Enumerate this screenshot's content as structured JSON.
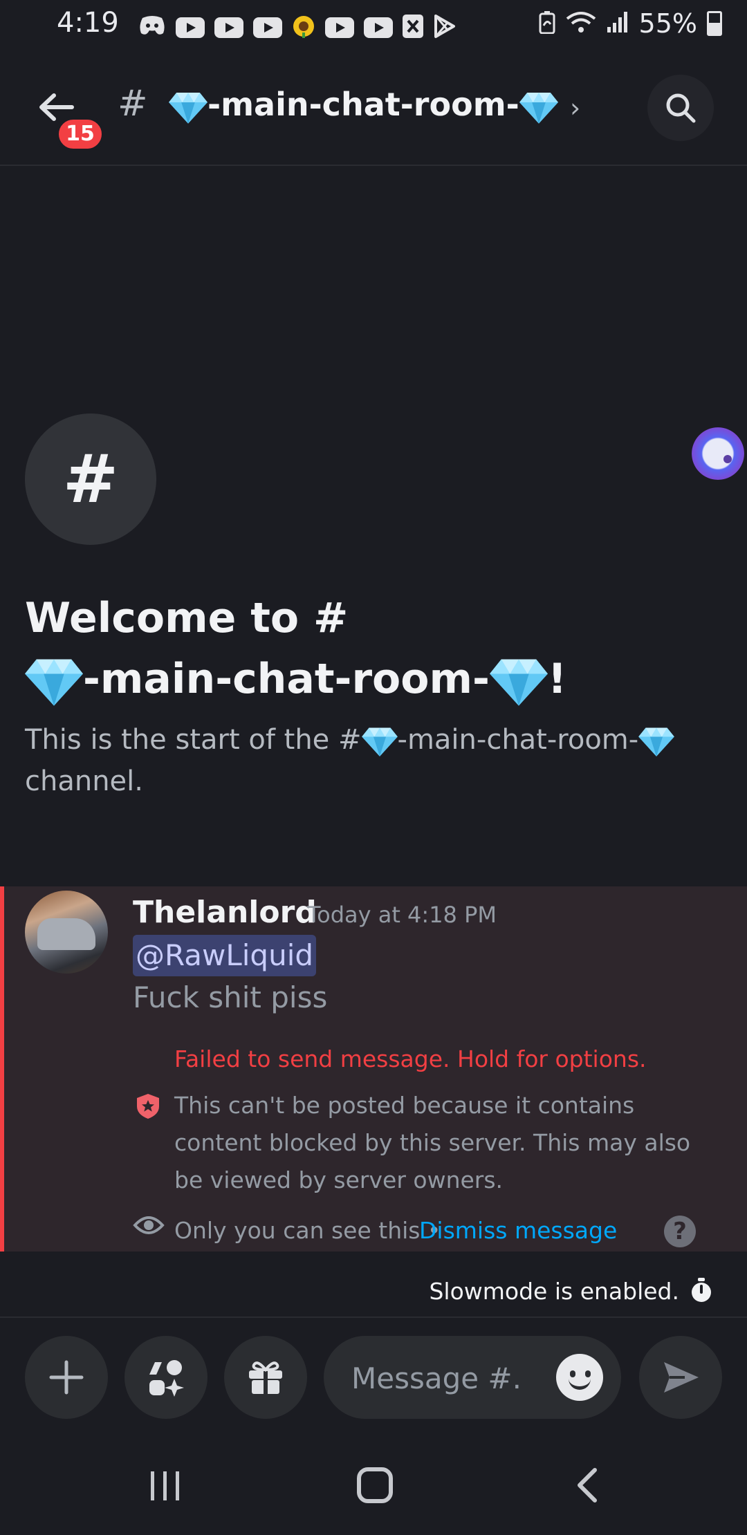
{
  "status_bar": {
    "time": "4:19",
    "battery": "55%",
    "notification_icons": [
      "discord-icon",
      "youtube-icon",
      "youtube-icon",
      "youtube-icon",
      "sunflower-icon",
      "youtube-icon",
      "youtube-icon",
      "x-icon",
      "play-store-icon"
    ],
    "system_icons": [
      "battery-saver-icon",
      "wifi-icon",
      "signal-icon",
      "battery-icon"
    ]
  },
  "header": {
    "unread_count": "15",
    "hash": "#",
    "channel_name": "-main-chat-room-",
    "chevron": "›"
  },
  "welcome": {
    "icon_glyph": "#",
    "title_line1": "Welcome to #",
    "title_line2_name": "-main-chat-room-",
    "title_line2_suffix": "!",
    "desc_prefix": "This is the start of the #",
    "desc_name": "-main-chat-room-",
    "desc_suffix": "channel."
  },
  "message": {
    "username": "Thelanlord",
    "timestamp": "Today at 4:18 PM",
    "mention": "@RawLiquid",
    "text": "Fuck shit piss",
    "error": "Failed to send message. Hold for options.",
    "blocked_notice": "This can't be posted because it contains content blocked by this server. This may also be viewed by server owners.",
    "ephemeral_note": "Only you can see this •",
    "dismiss_label": "Dismiss message",
    "help_glyph": "?"
  },
  "slowmode": {
    "text": "Slowmode is enabled."
  },
  "composer": {
    "placeholder": "Message #..."
  },
  "colors": {
    "background": "#1b1c22",
    "error_red": "#f23f43",
    "link_blue": "#00a8fc",
    "mention_bg": "#3c4270",
    "diamond": "#4fc3f7"
  }
}
